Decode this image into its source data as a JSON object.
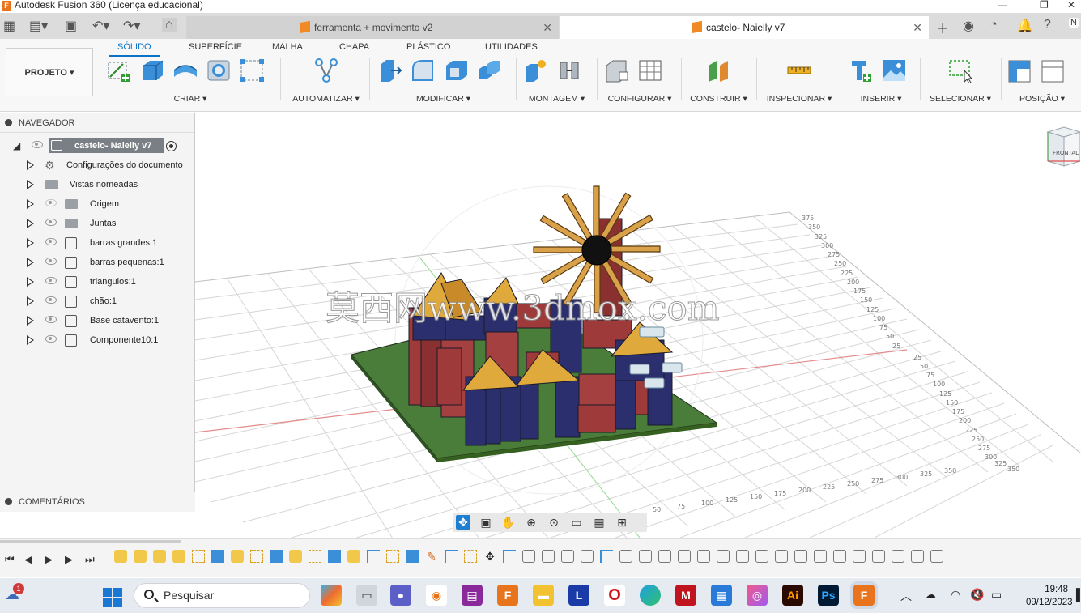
{
  "window": {
    "title": "Autodesk Fusion 360 (Licença educacional)"
  },
  "doc_tabs": [
    {
      "label": "ferramenta + movimento v2"
    },
    {
      "label": "castelo- Naielly v7"
    }
  ],
  "ribbon": {
    "tabs": [
      "SÓLIDO",
      "SUPERFÍCIE",
      "MALHA",
      "CHAPA",
      "PLÁSTICO",
      "UTILIDADES"
    ],
    "active_tab": "SÓLIDO",
    "workspace_button": "PROJETO",
    "groups": [
      "CRIAR",
      "AUTOMATIZAR",
      "MODIFICAR",
      "MONTAGEM",
      "CONFIGURAR",
      "CONSTRUIR",
      "INSPECIONAR",
      "INSERIR",
      "SELECIONAR",
      "POSIÇÃO"
    ]
  },
  "navigator": {
    "header": "NAVEGADOR",
    "root": "castelo- Naielly v7",
    "items": [
      {
        "label": "Configurações do documento",
        "icon": "gear-icon"
      },
      {
        "label": "Vistas nomeadas",
        "icon": "folder-icon"
      },
      {
        "label": "Origem",
        "icon": "folder-icon"
      },
      {
        "label": "Juntas",
        "icon": "folder-icon"
      },
      {
        "label": "barras grandes:1",
        "icon": "component-icon"
      },
      {
        "label": "barras pequenas:1",
        "icon": "component-icon"
      },
      {
        "label": "triangulos:1",
        "icon": "component-icon"
      },
      {
        "label": "chão:1",
        "icon": "component-icon"
      },
      {
        "label": "Base catavento:1",
        "icon": "component-icon"
      },
      {
        "label": "Componente10:1",
        "icon": "component-icon"
      }
    ],
    "comments": "COMENTÁRIOS"
  },
  "viewport": {
    "watermark": "莫西网www.3dmox.com",
    "viewcube_label": "FRONTAL",
    "grid_labels_right": [
      "375",
      "350",
      "325",
      "300",
      "275",
      "250",
      "225",
      "200",
      "175",
      "150",
      "125",
      "100",
      "75",
      "50",
      "25",
      "25",
      "50",
      "75",
      "100",
      "125",
      "150",
      "175",
      "200",
      "225",
      "250",
      "275",
      "300",
      "325",
      "350"
    ],
    "grid_labels_bottom": [
      "50",
      "75",
      "100",
      "125",
      "150",
      "175",
      "200",
      "225",
      "250",
      "275",
      "300",
      "325",
      "350"
    ]
  },
  "taskbar": {
    "search_placeholder": "Pesquisar",
    "time": "19:48",
    "date": "09/12/2023",
    "notification_count": "1"
  },
  "colors": {
    "accent": "#0a73c8",
    "brick": "#9e3a3a",
    "navy": "#2c2f6e",
    "gold": "#e0a93c",
    "ground": "#4b7d3a",
    "windmill": "#d9a24a"
  }
}
